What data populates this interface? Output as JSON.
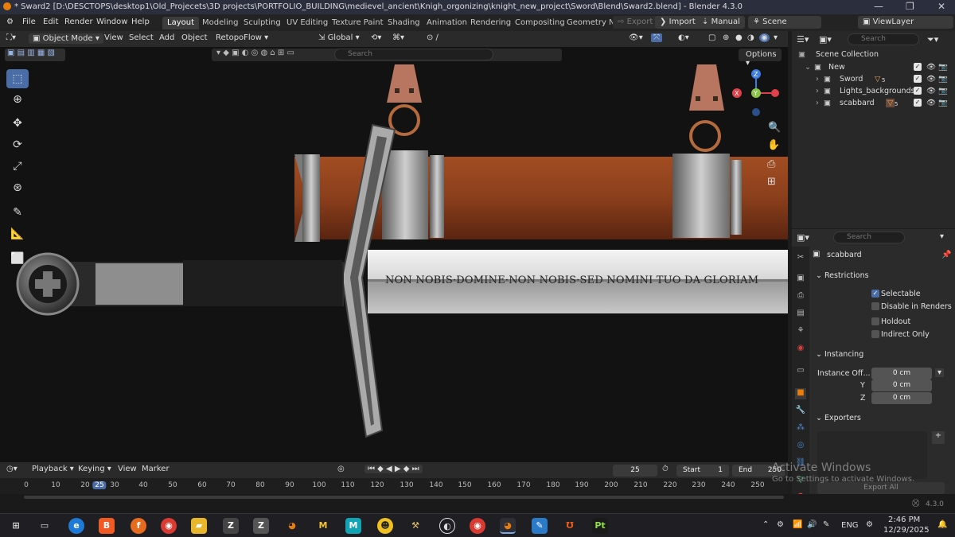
{
  "window": {
    "title": "* Sward2 [D:\\DESCTOPS\\desktop1\\Old_Projecets\\3D projects\\PORTFOLIO_BUILDING\\medievel_ancient\\Knigh_orgonizing\\knight_new_project\\Sword\\Blend\\Sward2.blend] - Blender 4.3.0"
  },
  "menu": [
    "File",
    "Edit",
    "Render",
    "Window",
    "Help"
  ],
  "workspaces": [
    "Layout",
    "Modeling",
    "Sculpting",
    "UV Editing",
    "Texture Paint",
    "Shading",
    "Animation",
    "Rendering",
    "Compositing",
    "Geometry N"
  ],
  "top_right": {
    "export": "Export",
    "import": "Import",
    "manual": "Manual",
    "scene": "Scene",
    "view_layer": "ViewLayer"
  },
  "viewport_header": {
    "mode": "Object Mode",
    "view": "View",
    "select": "Select",
    "add": "Add",
    "object": "Object",
    "addon": "RetopoFlow",
    "orientation": "Global",
    "search_placeholder": "Search",
    "options": "Options"
  },
  "inscription": "NON NOBIS·DOMINE·NON NOBIS·SED NOMINI TUO DA GLORIAM",
  "outliner": {
    "search_placeholder": "Search",
    "scene_collection": "Scene Collection",
    "items": [
      {
        "name": "New"
      },
      {
        "name": "Sword",
        "badge": "5"
      },
      {
        "name": "Lights_backgrounds"
      },
      {
        "name": "scabbard",
        "badge": "5"
      }
    ]
  },
  "properties": {
    "search_placeholder": "Search",
    "object_name": "scabbard",
    "restrictions_title": "Restrictions",
    "selectable": "Selectable",
    "disable_in_renders": "Disable in Renders",
    "holdout": "Holdout",
    "indirect_only": "Indirect Only",
    "instancing_title": "Instancing",
    "instance_offset_label": "Instance Off...",
    "instance_x": "0 cm",
    "y_label": "Y",
    "instance_y": "0 cm",
    "z_label": "Z",
    "instance_z": "0 cm",
    "exporters_title": "Exporters",
    "export_all": "Export All"
  },
  "timeline": {
    "playback": "Playback",
    "keying": "Keying",
    "view": "View",
    "marker": "Marker",
    "current_frame": "25",
    "start_label": "Start",
    "start": "1",
    "end_label": "End",
    "end": "250",
    "ticks": [
      "0",
      "10",
      "20",
      "25",
      "30",
      "40",
      "50",
      "60",
      "70",
      "80",
      "90",
      "100",
      "110",
      "120",
      "130",
      "140",
      "150",
      "160",
      "170",
      "180",
      "190",
      "200",
      "210",
      "220",
      "230",
      "240",
      "250"
    ]
  },
  "status": {
    "version": "4.3.0"
  },
  "watermark": {
    "line1": "Activate Windows",
    "line2": "Go to Settings to activate Windows."
  },
  "taskbar": {
    "lang": "ENG",
    "time": "2:46 PM",
    "date": "12/29/2025"
  },
  "colors": {
    "accent": "#4a6da7",
    "scabbard_leather": "#8a3f1c",
    "axis_x": "#e0404a",
    "axis_y": "#8bc34a",
    "axis_z": "#3d7ce0"
  }
}
